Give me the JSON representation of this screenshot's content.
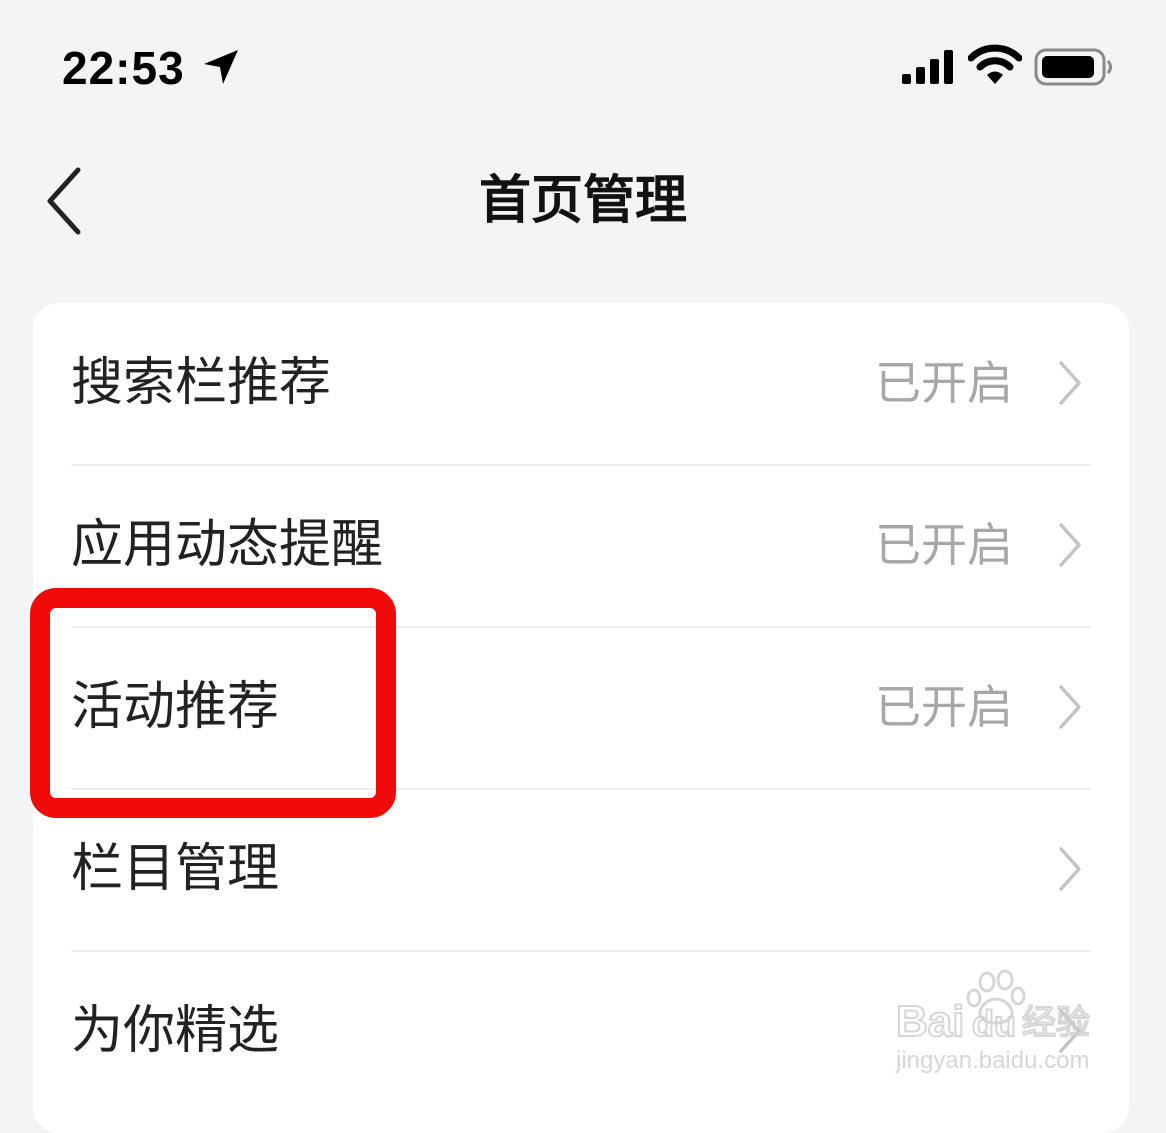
{
  "status_bar": {
    "time": "22:53"
  },
  "nav": {
    "back_icon": "chevron-left-icon",
    "title": "首页管理"
  },
  "settings": {
    "items": [
      {
        "label": "搜索栏推荐",
        "value": "已开启"
      },
      {
        "label": "应用动态提醒",
        "value": "已开启"
      },
      {
        "label": "活动推荐",
        "value": "已开启",
        "highlighted": true
      },
      {
        "label": "栏目管理",
        "value": ""
      },
      {
        "label": "为你精选",
        "value": ""
      }
    ]
  },
  "watermark": {
    "brand": "Baidu经验",
    "url": "jingyan.baidu.com"
  },
  "colors": {
    "background": "#f3f4f6",
    "card": "#ffffff",
    "value_text": "#a7a7a7",
    "highlight": "#f20a0a"
  }
}
